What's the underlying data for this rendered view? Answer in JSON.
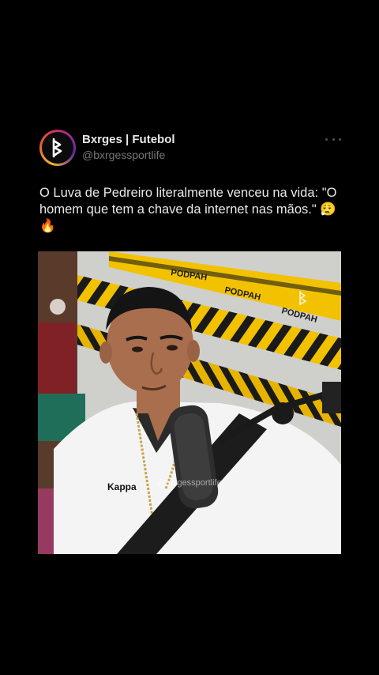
{
  "author": {
    "name": "Bxrges | Futebol",
    "handle": "@bxrgessportlife",
    "avatar_letter": "B"
  },
  "more_icon": "ellipsis-horizontal-icon",
  "tweet": {
    "text": "O Luva de Pedreiro literalmente venceu na vida: \"O homem que tem a chave da internet nas mãos.\" 😮‍💨🔥"
  },
  "media": {
    "tape_labels": [
      "PODPAH",
      "PODPAH",
      "PODPAH"
    ],
    "watermark": "@bxrgessportlife",
    "shirt_brand": "Kappa",
    "colors": {
      "tape": "#f2c200",
      "tape_stripe": "#1a1a1a",
      "wall": "#c9c9c6",
      "shirt": "#f4f4f4",
      "skin": "#a86e4d"
    }
  },
  "colors": {
    "background": "#000000",
    "text": "#e7e9ea",
    "secondary_text": "#71767b"
  }
}
